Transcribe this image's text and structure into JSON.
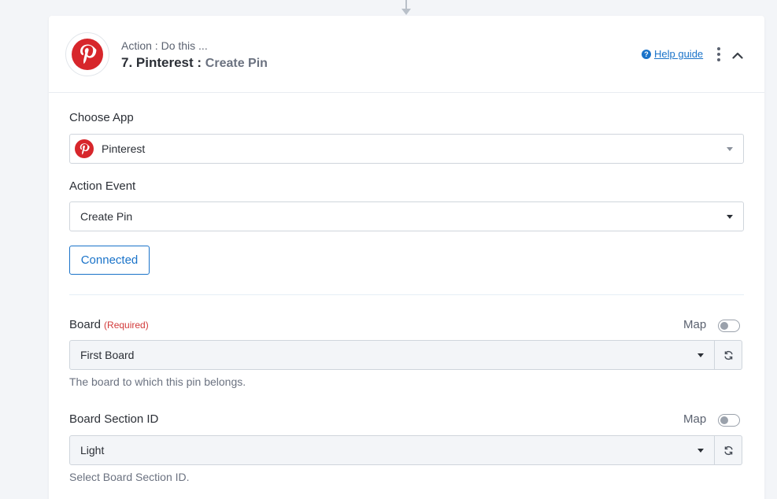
{
  "header": {
    "subtitle": "Action : Do this ...",
    "step_title": "7. Pinterest :",
    "step_event": "Create Pin",
    "help_label": "Help guide"
  },
  "choose_app": {
    "label": "Choose App",
    "value": "Pinterest"
  },
  "action_event": {
    "label": "Action Event",
    "value": "Create Pin"
  },
  "connection": {
    "button_label": "Connected"
  },
  "board": {
    "label": "Board",
    "required_label": "(Required)",
    "map_label": "Map",
    "map_enabled": false,
    "value": "First Board",
    "hint": "The board to which this pin belongs."
  },
  "board_section": {
    "label": "Board Section ID",
    "map_label": "Map",
    "map_enabled": false,
    "value": "Light",
    "hint": "Select Board Section ID."
  },
  "colors": {
    "pinterest_red": "#d7262b",
    "accent_blue": "#1a73c9",
    "required_red": "#d23a3a"
  },
  "icons": {
    "app_logo": "pinterest-logo-icon",
    "help": "question-circle-icon",
    "menu": "kebab-menu-icon",
    "collapse": "chevron-up-icon",
    "dropdown": "caret-down-icon",
    "refresh": "refresh-icon"
  }
}
